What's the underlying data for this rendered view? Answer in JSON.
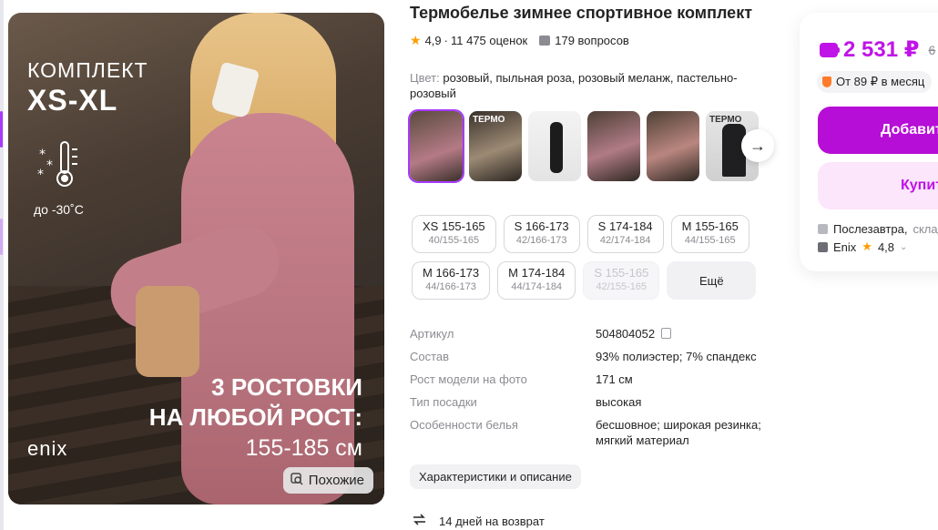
{
  "product": {
    "title": "Термобелье зимнее спортивное комплект",
    "rating": "4,9",
    "reviews": "11 475 оценок",
    "questions": "179 вопросов",
    "color_label": "Цвет:",
    "color_value": "розовый, пыльная роза, розовый меланж, пастельно-розовый"
  },
  "photo": {
    "kit_label": "КОМПЛЕКТ",
    "kit_sizes": "XS-XL",
    "temperature": "до -30˚С",
    "promo_line1": "3 РОСТОВКИ",
    "promo_line2": "НА ЛЮБОЙ РОСТ:",
    "promo_line3": "155-185 см",
    "brand": "enix",
    "similar_label": "Похожие"
  },
  "thumbnails": [
    {
      "label": "",
      "selected": true
    },
    {
      "label": "ТЕРМО",
      "selected": false
    },
    {
      "label": "",
      "selected": false
    },
    {
      "label": "",
      "selected": false
    },
    {
      "label": "",
      "selected": false
    },
    {
      "label": "ТЕРМО",
      "selected": false
    }
  ],
  "sizes": [
    {
      "main": "XS 155-165",
      "sub": "40/155-165",
      "disabled": false
    },
    {
      "main": "S 166-173",
      "sub": "42/166-173",
      "disabled": false
    },
    {
      "main": "S 174-184",
      "sub": "42/174-184",
      "disabled": false
    },
    {
      "main": "M 155-165",
      "sub": "44/155-165",
      "disabled": false
    },
    {
      "main": "M 166-173",
      "sub": "44/166-173",
      "disabled": false
    },
    {
      "main": "M 174-184",
      "sub": "44/174-184",
      "disabled": false
    },
    {
      "main": "S 155-165",
      "sub": "42/155-165",
      "disabled": true
    }
  ],
  "sizes_more_label": "Ещё",
  "specs": [
    {
      "key": "Артикул",
      "value": "504804052"
    },
    {
      "key": "Состав",
      "value": "93% полиэстер; 7% спандекс"
    },
    {
      "key": "Рост модели на фото",
      "value": "171 см"
    },
    {
      "key": "Тип посадки",
      "value": "высокая"
    },
    {
      "key": "Особенности белья",
      "value": "бесшовное; широкая резинка; мягкий материал"
    }
  ],
  "characteristics_button": "Характеристики и описание",
  "return_text": "14 дней на возврат",
  "card": {
    "price": "2 531 ₽",
    "old_price": "6",
    "installment": "От 89 ₽ в месяц",
    "add_button": "Добавит",
    "buy_button": "Купит",
    "delivery": "Послезавтра,",
    "delivery_muted": "склад",
    "seller": "Enix",
    "seller_rating": "4,8"
  },
  "colors": {
    "accent": "#c013e8",
    "primary_button": "#b60ed6",
    "star": "#ff9d00"
  },
  "icons": [
    "star-icon",
    "question-icon",
    "copy-icon",
    "return-icon",
    "wallet-icon",
    "shield-icon",
    "arrow-right-icon",
    "similar-icon",
    "thermometer-icon",
    "box-icon",
    "seller-icon",
    "chevron-down-icon"
  ]
}
